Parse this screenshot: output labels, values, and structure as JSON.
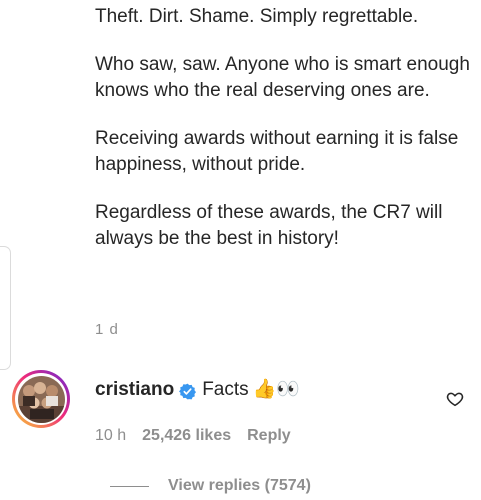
{
  "comment": {
    "paragraphs": [
      "Theft. Dirt. Shame. Simply regrettable.",
      "Who saw, saw. Anyone who is smart enough knows who the real deserving ones are.",
      "Receiving awards without earning it is false happiness, without pride.",
      "Regardless of these awards, the CR7 will always be the best in history!"
    ],
    "time": "1 d"
  },
  "reply": {
    "avatar_icon": "profile-photo",
    "username": "cristiano",
    "verified_icon": "verified-badge-icon",
    "verified_color": "#3897f0",
    "text": "Facts",
    "emoji": "👍👀",
    "like_icon": "heart-outline-icon",
    "time": "10 h",
    "likes": "25,426 likes",
    "reply_label": "Reply"
  },
  "view_replies": {
    "label": "View replies (7574)"
  },
  "colors": {
    "text": "#262626",
    "muted": "#8e8e8e",
    "border": "#dbdbdb"
  }
}
